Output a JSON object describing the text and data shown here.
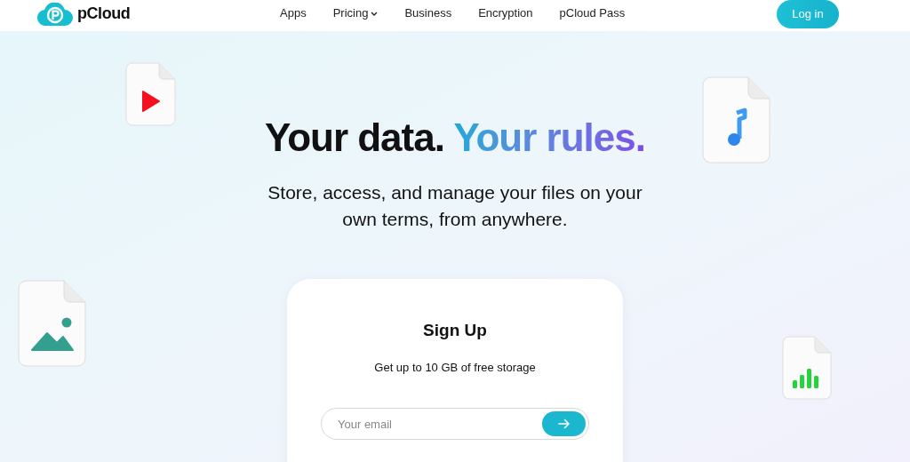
{
  "header": {
    "logo": "pCloud",
    "nav": [
      {
        "label": "Apps",
        "has_menu": false
      },
      {
        "label": "Pricing",
        "has_menu": true
      },
      {
        "label": "Business",
        "has_menu": false
      },
      {
        "label": "Encryption",
        "has_menu": false
      },
      {
        "label": "pCloud Pass",
        "has_menu": false
      }
    ],
    "login_button": "Log in"
  },
  "hero": {
    "headline": {
      "text": "Your data.",
      "highlight": "Your rules."
    },
    "subtitle": "Store, access, and manage your files on your own terms, from anywhere."
  },
  "signup": {
    "title": "Sign Up",
    "subtitle": "Get up to 10 GB of free storage",
    "email": {
      "placeholder": "Your email"
    }
  }
}
